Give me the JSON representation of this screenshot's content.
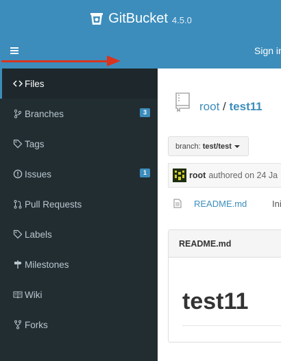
{
  "header": {
    "app_name": "GitBucket",
    "version": "4.5.0",
    "signin_label": "Sign in",
    "brand_color": "#3c8dbc",
    "icons": {
      "logo": "gitbucket-logo-icon",
      "menu": "hamburger-menu-icon"
    }
  },
  "annotation": {
    "arrow_color": "#d9341e"
  },
  "sidebar": {
    "items": [
      {
        "label": "Files",
        "icon": "code-icon",
        "active": true
      },
      {
        "label": "Branches",
        "icon": "branch-icon",
        "badge": "3"
      },
      {
        "label": "Tags",
        "icon": "tag-icon"
      },
      {
        "label": "Issues",
        "icon": "issue-icon",
        "badge": "1"
      },
      {
        "label": "Pull Requests",
        "icon": "pull-request-icon"
      },
      {
        "label": "Labels",
        "icon": "tag-icon"
      },
      {
        "label": "Milestones",
        "icon": "milestone-icon"
      },
      {
        "label": "Wiki",
        "icon": "book-icon"
      },
      {
        "label": "Forks",
        "icon": "fork-icon"
      }
    ]
  },
  "repo": {
    "owner": "root",
    "separator": "/",
    "name": "test11",
    "icon": "repo-icon"
  },
  "branch": {
    "prefix": "branch:",
    "name": "test/test"
  },
  "commit": {
    "author": "root",
    "text": "authored on 24 Ja"
  },
  "files": [
    {
      "name": "README.md",
      "message": "Ini",
      "icon": "file-text-icon"
    }
  ],
  "readme": {
    "title": "README.md",
    "heading": "test11"
  }
}
